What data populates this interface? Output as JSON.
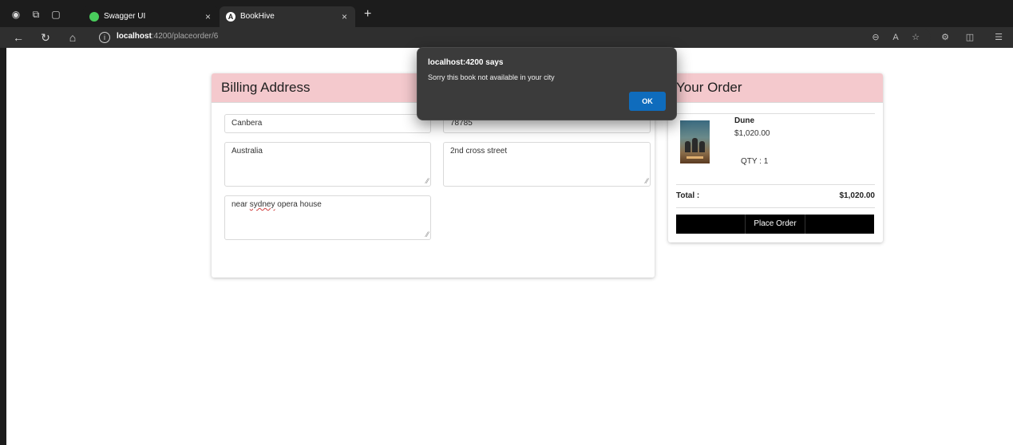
{
  "browser": {
    "tabs": [
      {
        "title": "Swagger UI",
        "active": false,
        "favicon_color": "#49cc5c"
      },
      {
        "title": "BookHive",
        "active": true,
        "favicon_color": "#ffffff"
      }
    ],
    "tab_close_glyph": "×",
    "new_tab_glyph": "+",
    "url": {
      "host": "localhost",
      "rest": ":4200/placeorder/6"
    }
  },
  "billing": {
    "heading": "Billing Address",
    "city": "Canbera",
    "pincode": "78785",
    "country": "Australia",
    "street": "2nd cross street",
    "landmark_prefix": "near ",
    "landmark_misspelled": "sydney",
    "landmark_suffix": " opera house"
  },
  "order": {
    "heading": "Your Order",
    "item": {
      "title": "Dune",
      "price": "$1,020.00",
      "qty": "QTY : 1"
    },
    "total_label": "Total :",
    "total_value": "$1,020.00",
    "place_order_label": "Place Order"
  },
  "alert": {
    "title": "localhost:4200 says",
    "message": "Sorry this book not available in your city",
    "ok_label": "OK"
  },
  "colors": {
    "card_header": "#f4c9cd",
    "alert_bg": "#3b3b3b",
    "ok_button": "#0f6cbd",
    "place_order_bg": "#000000"
  }
}
